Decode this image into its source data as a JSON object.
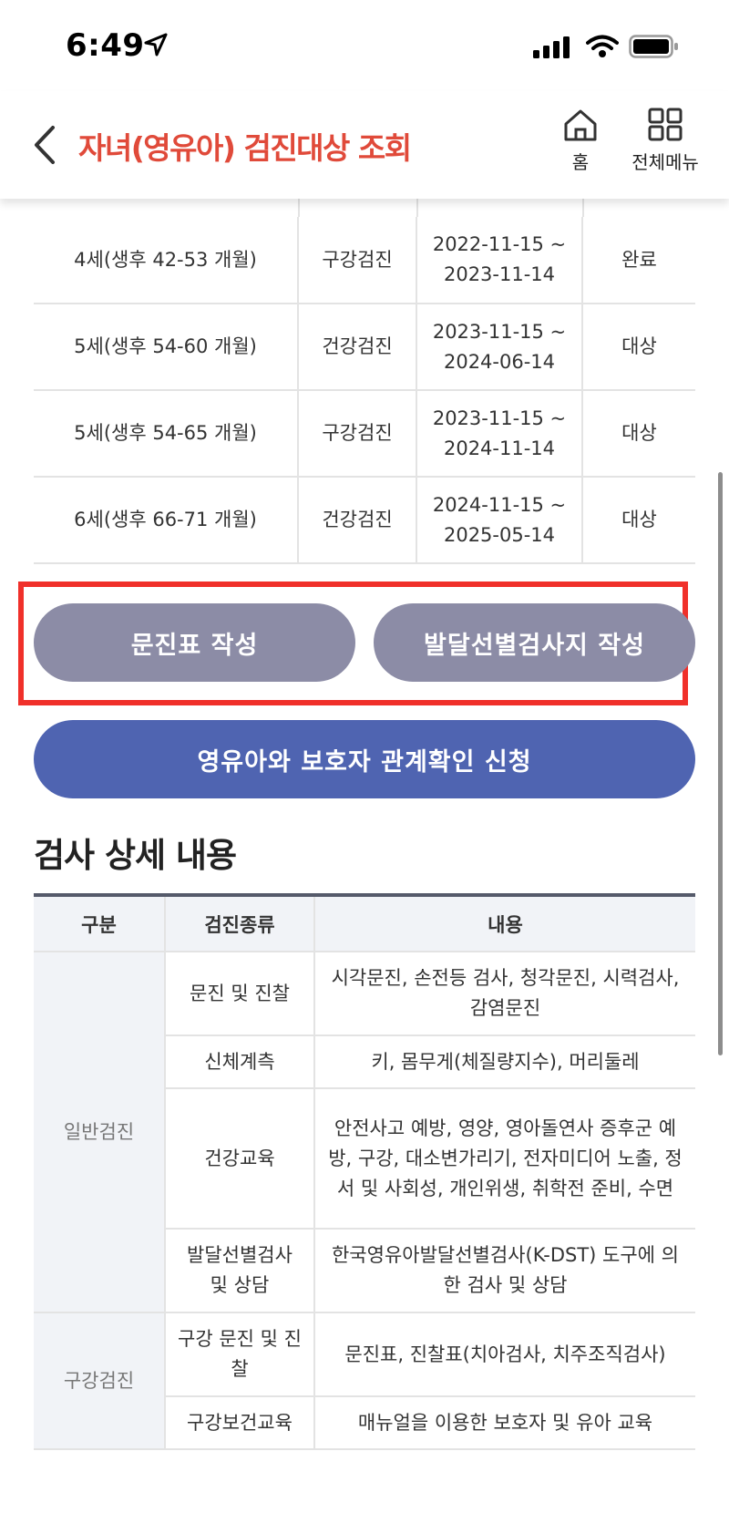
{
  "status": {
    "time": "6:49"
  },
  "header": {
    "title": "자녀(영유아) 검진대상 조회",
    "home_label": "홈",
    "menu_label": "전체메뉴"
  },
  "schedule": {
    "rows": [
      {
        "age": "4세(생후 42-53 개월)",
        "type": "구강검진",
        "period": "2022-11-15 ~",
        "period_end": "2023-11-14",
        "status": "완료"
      },
      {
        "age": "5세(생후 54-60 개월)",
        "type": "건강검진",
        "period": "2023-11-15 ~",
        "period_end": "2024-06-14",
        "status": "대상"
      },
      {
        "age": "5세(생후 54-65 개월)",
        "type": "구강검진",
        "period": "2023-11-15 ~",
        "period_end": "2024-11-14",
        "status": "대상"
      },
      {
        "age": "6세(생후 66-71 개월)",
        "type": "건강검진",
        "period": "2024-11-15 ~",
        "period_end": "2025-05-14",
        "status": "대상"
      }
    ]
  },
  "actions": {
    "questionnaire": "문진표 작성",
    "dev_screening": "발달선별검사지 작성",
    "relation_request": "영유아와 보호자 관계확인 신청"
  },
  "details": {
    "title": "검사 상세 내용",
    "headers": [
      "구분",
      "검진종류",
      "내용"
    ],
    "general": {
      "category": "일반검진",
      "rows": [
        {
          "kind": "문진 및 진찰",
          "desc": "시각문진, 손전등 검사, 청각문진, 시력검사, 감염문진"
        },
        {
          "kind": "신체계측",
          "desc": "키, 몸무게(체질량지수), 머리둘레"
        },
        {
          "kind": "건강교육",
          "desc": "안전사고 예방, 영양, 영아돌연사 증후군 예방, 구강, 대소변가리기, 전자미디어 노출, 정서 및 사회성, 개인위생, 취학전 준비, 수면"
        },
        {
          "kind": "발달선별검사 및 상담",
          "desc": "한국영유아발달선별검사(K-DST) 도구에 의한 검사 및 상담"
        }
      ]
    },
    "oral": {
      "category": "구강검진",
      "rows": [
        {
          "kind": "구강 문진 및 진찰",
          "desc": "문진표, 진찰표(치아검사, 치주조직검사)"
        },
        {
          "kind": "구강보건교육",
          "desc": "매뉴얼을 이용한 보호자 및 유아 교육"
        }
      ]
    }
  },
  "colors": {
    "title": "#e04a3a",
    "gray_button": "#8c8ca6",
    "blue_button": "#4f64b1",
    "highlight": "#f0302a"
  }
}
